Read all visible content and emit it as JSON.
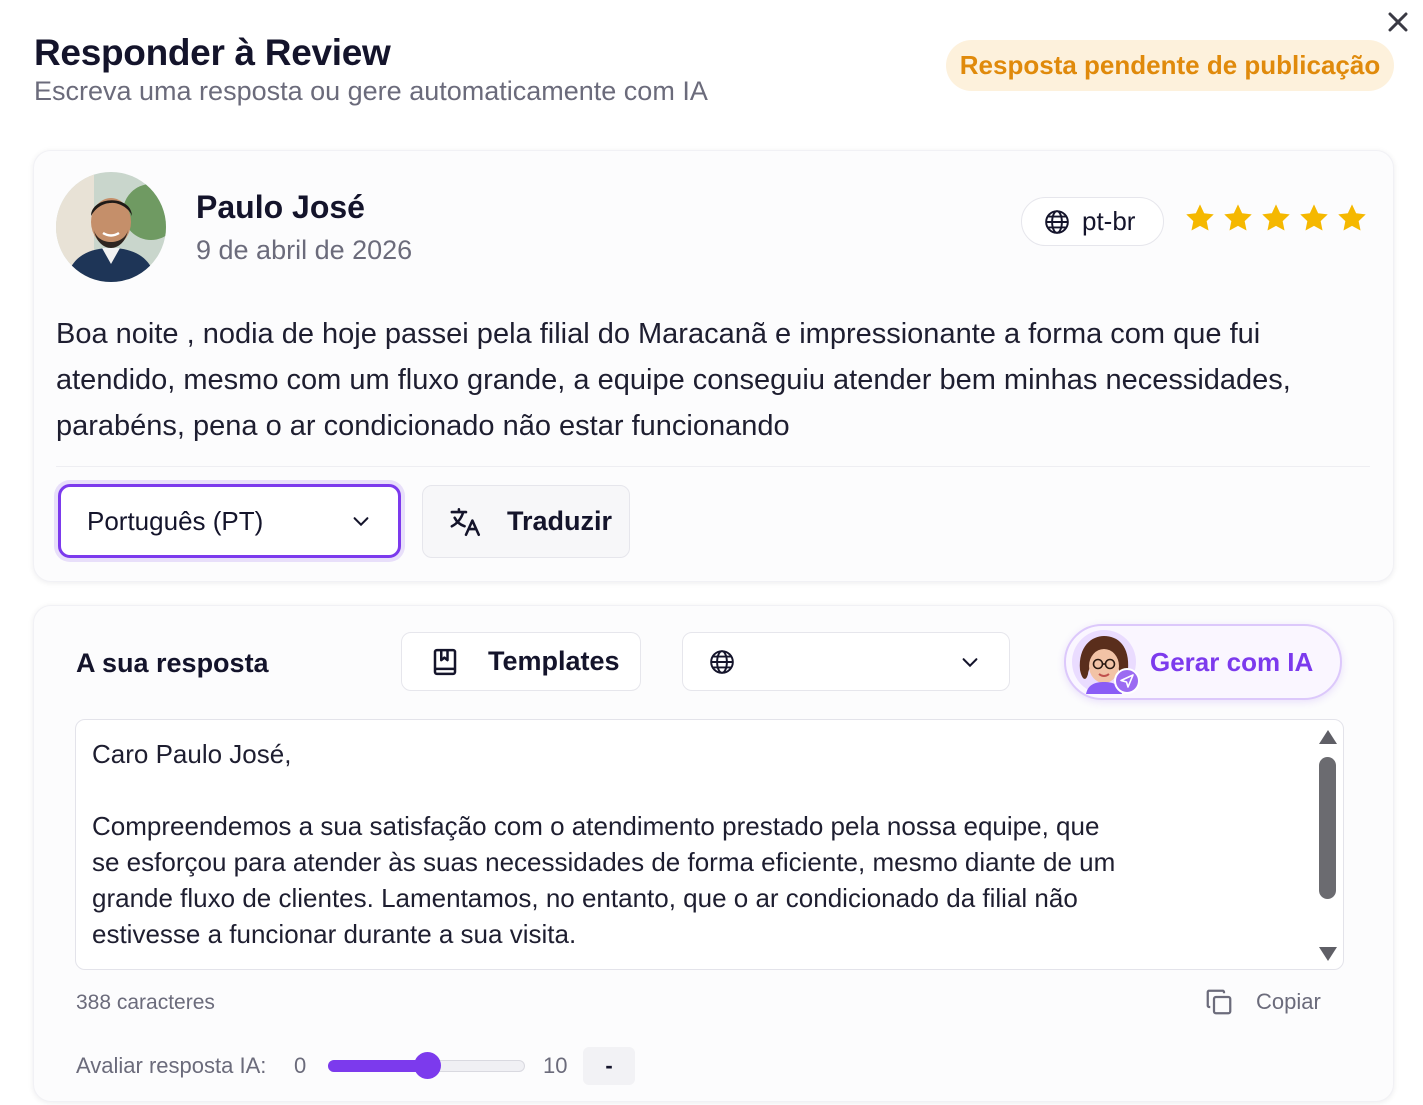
{
  "header": {
    "title": "Responder à Review",
    "subtitle": "Escreva uma resposta ou gere automaticamente com IA",
    "status_badge": "Resposta pendente de publicação"
  },
  "review": {
    "reviewer_name": "Paulo José",
    "date": "9 de abril de 2026",
    "language_code": "pt-br",
    "rating": 5,
    "text": "Boa noite , nodia de hoje passei pela filial do Maracanã e impressionante a forma com que fui atendido, mesmo com um fluxo grande, a equipe conseguiu atender bem minhas necessidades, parabéns, pena o ar condicionado não estar funcionando",
    "language_select_value": "Português (PT)",
    "translate_label": "Traduzir"
  },
  "reply": {
    "label": "A sua resposta",
    "templates_label": "Templates",
    "language_dropdown_value": "",
    "generate_ai_label": "Gerar com IA",
    "text": "Caro Paulo José,\n\nCompreendemos a sua satisfação com o atendimento prestado pela nossa equipe, que\nse esforçou para atender às suas necessidades de forma eficiente, mesmo diante de um\ngrande fluxo de clientes. Lamentamos, no entanto, que o ar condicionado da filial não\nestivesse a funcionar durante a sua visita.",
    "char_count": "388 caracteres",
    "copy_label": "Copiar"
  },
  "ai_rating": {
    "label": "Avaliar resposta IA:",
    "min": "0",
    "max": "10",
    "slider_value": 5,
    "value_display": "-"
  },
  "icons": {
    "close": "close-icon",
    "globe": "globe-icon",
    "star": "star-icon",
    "chevron": "chevron-down-icon",
    "translate": "translate-icon",
    "templates": "book-icon",
    "copy": "copy-icon"
  },
  "colors": {
    "accent": "#7c3aed",
    "star": "#f5b800",
    "badge_bg": "#fdf1dc",
    "badge_text": "#e08a0b"
  }
}
